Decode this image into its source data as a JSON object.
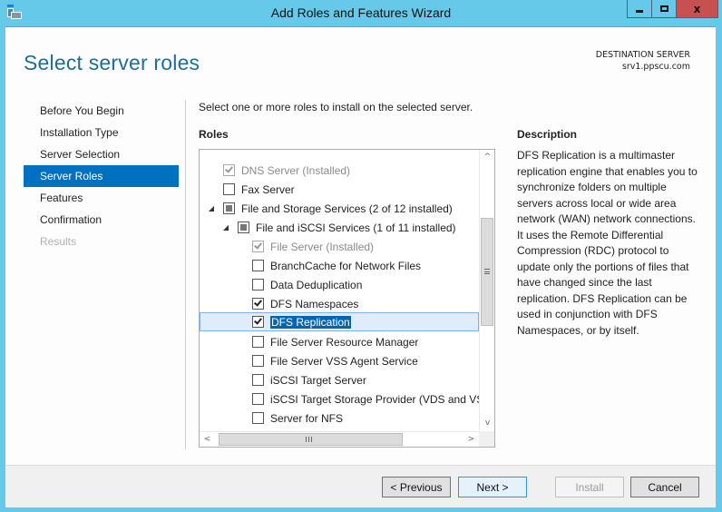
{
  "window": {
    "title": "Add Roles and Features Wizard",
    "controls": {
      "minimize": "minimize",
      "maximize": "maximize",
      "close": "x"
    }
  },
  "header": {
    "page_title": "Select server roles",
    "destination_label": "DESTINATION SERVER",
    "destination_value": "srv1.ppscu.com"
  },
  "nav": {
    "items": [
      {
        "label": "Before You Begin",
        "state": "normal"
      },
      {
        "label": "Installation Type",
        "state": "normal"
      },
      {
        "label": "Server Selection",
        "state": "normal"
      },
      {
        "label": "Server Roles",
        "state": "active"
      },
      {
        "label": "Features",
        "state": "normal"
      },
      {
        "label": "Confirmation",
        "state": "normal"
      },
      {
        "label": "Results",
        "state": "disabled"
      }
    ]
  },
  "main": {
    "instruction": "Select one or more roles to install on the selected server.",
    "roles_label": "Roles",
    "roles": [
      {
        "label": "DNS Server (Installed)",
        "level": 0,
        "expander": false,
        "check": "checked",
        "disabled": true,
        "selected": false
      },
      {
        "label": "Fax Server",
        "level": 0,
        "expander": false,
        "check": "unchecked",
        "disabled": false,
        "selected": false
      },
      {
        "label": "File and Storage Services (2 of 12 installed)",
        "level": 0,
        "expander": true,
        "check": "partial",
        "disabled": false,
        "selected": false
      },
      {
        "label": "File and iSCSI Services (1 of 11 installed)",
        "level": 1,
        "expander": true,
        "check": "partial",
        "disabled": false,
        "selected": false
      },
      {
        "label": "File Server (Installed)",
        "level": 2,
        "expander": false,
        "check": "checked",
        "disabled": true,
        "selected": false
      },
      {
        "label": "BranchCache for Network Files",
        "level": 2,
        "expander": false,
        "check": "unchecked",
        "disabled": false,
        "selected": false
      },
      {
        "label": "Data Deduplication",
        "level": 2,
        "expander": false,
        "check": "unchecked",
        "disabled": false,
        "selected": false
      },
      {
        "label": "DFS Namespaces",
        "level": 2,
        "expander": false,
        "check": "checked",
        "disabled": false,
        "selected": false
      },
      {
        "label": "DFS Replication",
        "level": 2,
        "expander": false,
        "check": "checked",
        "disabled": false,
        "selected": true
      },
      {
        "label": "File Server Resource Manager",
        "level": 2,
        "expander": false,
        "check": "unchecked",
        "disabled": false,
        "selected": false
      },
      {
        "label": "File Server VSS Agent Service",
        "level": 2,
        "expander": false,
        "check": "unchecked",
        "disabled": false,
        "selected": false
      },
      {
        "label": "iSCSI Target Server",
        "level": 2,
        "expander": false,
        "check": "unchecked",
        "disabled": false,
        "selected": false
      },
      {
        "label": "iSCSI Target Storage Provider (VDS and VSS hardware providers)",
        "level": 2,
        "expander": false,
        "check": "unchecked",
        "disabled": false,
        "selected": false
      },
      {
        "label": "Server for NFS",
        "level": 2,
        "expander": false,
        "check": "unchecked",
        "disabled": false,
        "selected": false
      }
    ],
    "scrollbar_glyphs": {
      "up": "^",
      "down": "v",
      "left": "<",
      "right": ">"
    },
    "description_label": "Description",
    "description_text": "DFS Replication is a multimaster replication engine that enables you to synchronize folders on multiple servers across local or wide area network (WAN) network connections. It uses the Remote Differential Compression (RDC) protocol to update only the portions of files that have changed since the last replication. DFS Replication can be used in conjunction with DFS Namespaces, or by itself."
  },
  "footer": {
    "previous": "< Previous",
    "next": "Next >",
    "install": "Install",
    "cancel": "Cancel"
  },
  "colors": {
    "window_frame": "#67c9ea",
    "title_accent": "#1f6e93",
    "nav_active": "#0070c0",
    "close_button": "#c75050",
    "selection_highlight": "#0a64ad"
  }
}
